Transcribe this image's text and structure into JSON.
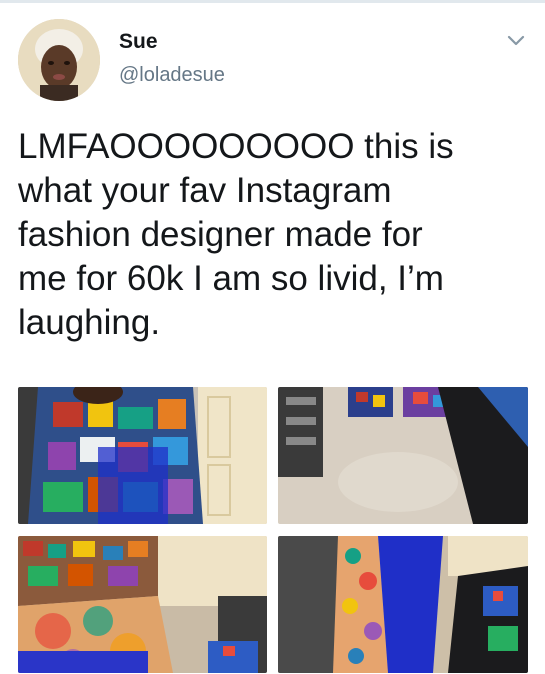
{
  "tweet": {
    "author_name": "Sue",
    "author_handle": "@loladesue",
    "text": "LMFAOOOOOOOOO this is\nwhat your fav Instagram\nfashion designer made for\nme for 60k I am so livid, I’m\nlaughing.",
    "menu_icon": "chevron-down-icon"
  },
  "media": {
    "photo_count": 4,
    "photos": [
      {
        "subject": "photo-1"
      },
      {
        "subject": "photo-2"
      },
      {
        "subject": "photo-3"
      },
      {
        "subject": "photo-4"
      }
    ]
  },
  "colors": {
    "text": "#14171a",
    "secondary": "#657786",
    "divider": "#e1e8ed"
  }
}
